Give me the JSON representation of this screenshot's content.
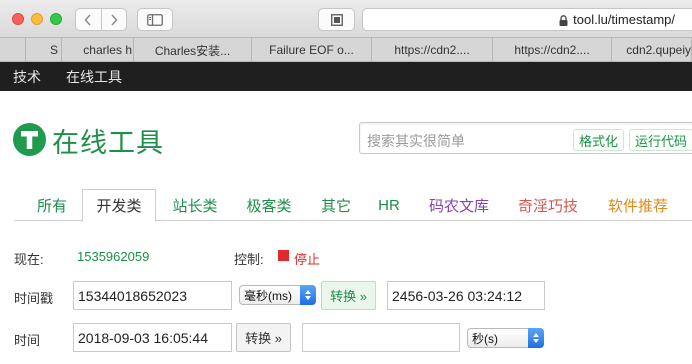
{
  "browser": {
    "url": "tool.lu/timestamp/",
    "tabs": [
      "",
      "S",
      "charles h",
      "Charles安装...",
      "Failure EOF o...",
      "https://cdn2....",
      "https://cdn2....",
      "cdn2.qupeiy"
    ]
  },
  "site_nav": {
    "items": [
      "技术",
      "在线工具"
    ]
  },
  "logo": {
    "text": "在线工具"
  },
  "search": {
    "placeholder": "搜索其实很简单",
    "format_label": "格式化",
    "run_label": "运行代码"
  },
  "categories": [
    {
      "label": "所有",
      "color": "#1d8f48"
    },
    {
      "label": "开发类",
      "color": "#333333"
    },
    {
      "label": "站长类",
      "color": "#1d8f48"
    },
    {
      "label": "极客类",
      "color": "#1d8f48"
    },
    {
      "label": "其它",
      "color": "#1d8f48"
    },
    {
      "label": "HR",
      "color": "#1d8f48"
    },
    {
      "label": "码农文库",
      "color": "#8a3fb8"
    },
    {
      "label": "奇淫巧技",
      "color": "#d9534f"
    },
    {
      "label": "软件推荐",
      "color": "#e08a1e"
    }
  ],
  "now": {
    "label": "现在:",
    "value": "1535962059",
    "control_label": "控制:",
    "stop_label": "停止"
  },
  "timestamp_row": {
    "label": "时间戳",
    "input_value": "15344018652023",
    "unit": "毫秒(ms)",
    "convert_label": "转换 »",
    "result_value": "2456-03-26 03:24:12"
  },
  "time_row": {
    "label": "时间",
    "input_value": "2018-09-03 16:05:44",
    "convert_label": "转换 »",
    "result_value": "",
    "unit": "秒(s)"
  }
}
